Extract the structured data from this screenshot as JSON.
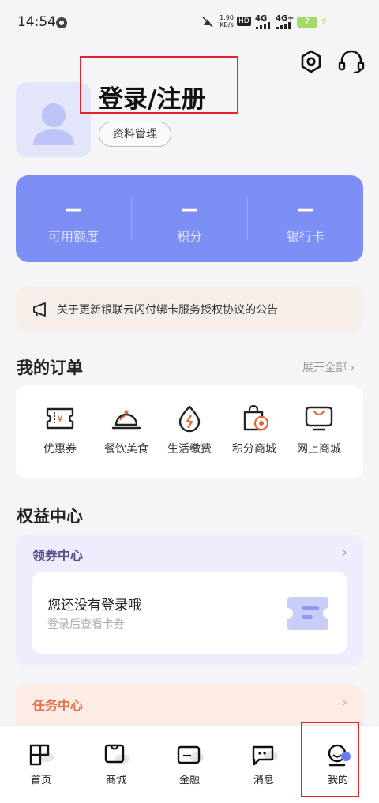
{
  "status_bar": {
    "time": "14:54",
    "speed": "1.90\nKB/s",
    "network1": "4G",
    "network2": "4G+",
    "battery": "7"
  },
  "header": {
    "login_title": "登录/注册",
    "profile_button": "资料管理"
  },
  "stats": [
    {
      "value": "—",
      "label": "可用额度"
    },
    {
      "value": "—",
      "label": "积分"
    },
    {
      "value": "—",
      "label": "银行卡"
    }
  ],
  "notice": {
    "text": "关于更新银联云闪付绑卡服务授权协议的公告"
  },
  "orders": {
    "title": "我的订单",
    "expand": "展开全部 ›",
    "items": [
      {
        "label": "优惠券",
        "icon": "coupon-icon"
      },
      {
        "label": "餐饮美食",
        "icon": "cloche-icon"
      },
      {
        "label": "生活缴费",
        "icon": "utility-icon"
      },
      {
        "label": "积分商城",
        "icon": "points-bag-icon"
      },
      {
        "label": "网上商城",
        "icon": "online-store-icon"
      }
    ]
  },
  "benefits": {
    "title": "权益中心",
    "coupon_center_title": "领券中心",
    "not_logged_in": "您还没有登录哦",
    "not_logged_in_sub": "登录后查看卡券",
    "task_center_title": "任务中心"
  },
  "nav": {
    "items": [
      {
        "label": "首页",
        "icon": "home-icon"
      },
      {
        "label": "商城",
        "icon": "mall-icon"
      },
      {
        "label": "金融",
        "icon": "finance-icon"
      },
      {
        "label": "消息",
        "icon": "message-icon"
      },
      {
        "label": "我的",
        "icon": "profile-icon"
      }
    ]
  },
  "colors": {
    "accent": "#7d8ff5",
    "highlight_box": "#e0262b",
    "coupon_bg": "#eeedfd",
    "task_bg": "#fdece6"
  }
}
